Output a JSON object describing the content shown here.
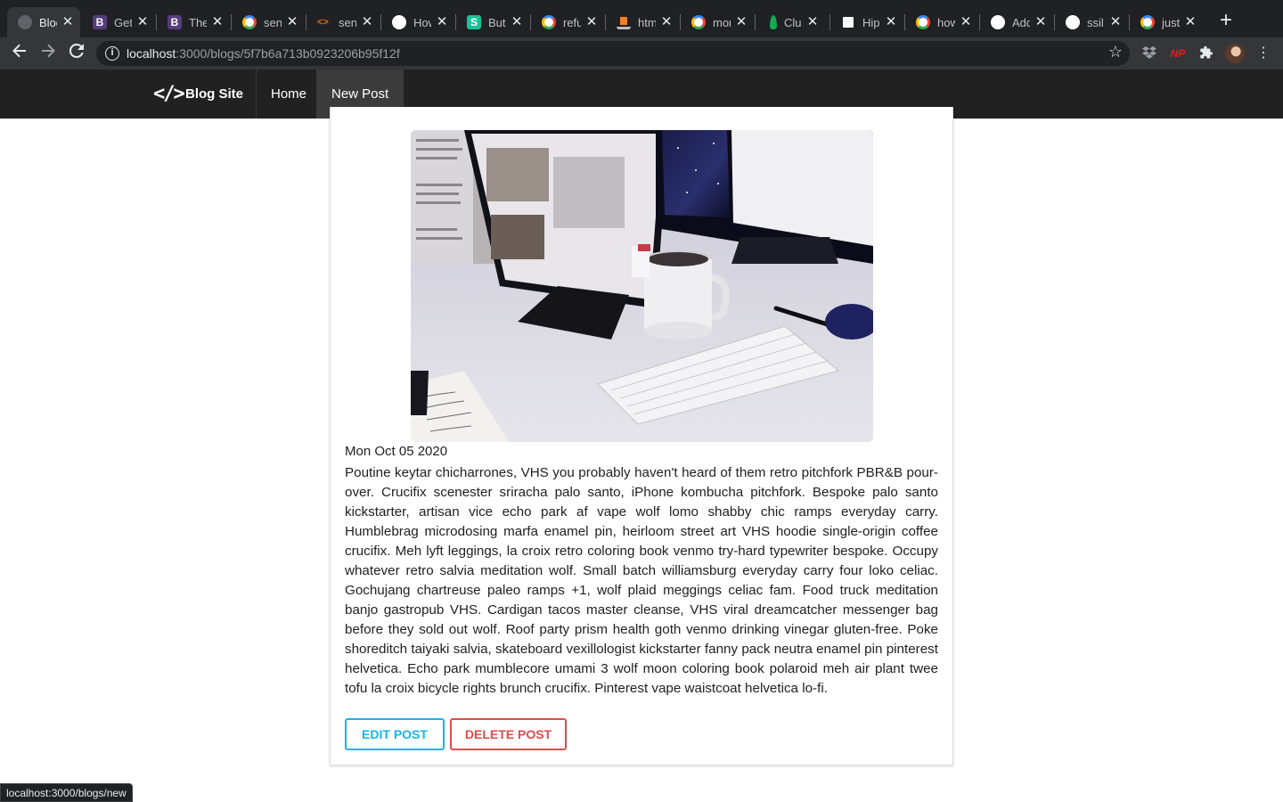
{
  "browser": {
    "tabs": [
      {
        "title": "Blog",
        "favicon": "globe-icon",
        "color": "#5f6368",
        "active": true
      },
      {
        "title": "Get",
        "favicon": "bootstrap-icon",
        "color": "#563d7c"
      },
      {
        "title": "The",
        "favicon": "bootstrap-icon",
        "color": "#563d7c"
      },
      {
        "title": "sen",
        "favicon": "google-icon",
        "color": "#ffffff"
      },
      {
        "title": "sen",
        "favicon": "code-icon",
        "color": "#e8710a"
      },
      {
        "title": "How",
        "favicon": "github-icon",
        "color": "#ffffff"
      },
      {
        "title": "But",
        "favicon": "s-icon",
        "color": "#15c39a"
      },
      {
        "title": "refu",
        "favicon": "google-icon",
        "color": "#ffffff"
      },
      {
        "title": "htm",
        "favicon": "stackoverflow-icon",
        "color": "#f48024"
      },
      {
        "title": "mor",
        "favicon": "google-icon",
        "color": "#ffffff"
      },
      {
        "title": "Clu",
        "favicon": "mongodb-leaf-icon",
        "color": "#13aa52"
      },
      {
        "title": "Hip",
        "favicon": "hipster-icon",
        "color": "#ffffff"
      },
      {
        "title": "how",
        "favicon": "google-icon",
        "color": "#ffffff"
      },
      {
        "title": "Add",
        "favicon": "github-icon",
        "color": "#ffffff"
      },
      {
        "title": "ssil",
        "favicon": "github-icon",
        "color": "#ffffff"
      },
      {
        "title": "just",
        "favicon": "google-icon",
        "color": "#ffffff"
      }
    ],
    "new_tab_symbol": "+",
    "close_symbol": "✕",
    "url_host": "localhost",
    "url_path": ":3000/blogs/5f7b6a713b0923206b95f12f",
    "extensions": [
      "dropbox-icon",
      "np-extension-icon",
      "puzzle-icon",
      "profile-avatar"
    ],
    "ext_np_label": "NP",
    "status_url": "localhost:3000/blogs/new"
  },
  "navbar": {
    "brand_icon": "</>",
    "brand": "Blog Site",
    "links": [
      {
        "label": "Home",
        "active": false
      },
      {
        "label": "New Post",
        "active": true
      }
    ]
  },
  "post": {
    "image_alt": "desk with monitors, mug and keyboard",
    "date": "Mon Oct 05 2020",
    "body": "Poutine keytar chicharrones, VHS you probably haven't heard of them retro pitchfork PBR&B pour-over. Crucifix scenester sriracha palo santo, iPhone kombucha pitchfork. Bespoke palo santo kickstarter, artisan vice echo park af vape wolf lomo shabby chic ramps everyday carry. Humblebrag microdosing marfa enamel pin, heirloom street art VHS hoodie single-origin coffee crucifix. Meh lyft leggings, la croix retro coloring book venmo try-hard typewriter bespoke. Occupy whatever retro salvia meditation wolf. Small batch williamsburg everyday carry four loko celiac. Gochujang chartreuse paleo ramps +1, wolf plaid meggings celiac fam. Food truck meditation banjo gastropub VHS. Cardigan tacos master cleanse, VHS viral dreamcatcher messenger bag before they sold out wolf. Roof party prism health goth venmo drinking vinegar gluten-free. Poke shoreditch taiyaki salvia, skateboard vexillologist kickstarter fanny pack neutra enamel pin pinterest helvetica. Echo park mumblecore umami 3 wolf moon coloring book polaroid meh air plant twee tofu la croix bicycle rights brunch crucifix. Pinterest vape waistcoat helvetica lo-fi.",
    "edit_label": "Edit Post",
    "delete_label": "Delete Post"
  },
  "colors": {
    "navbar_bg": "#212121",
    "edit_accent": "#17b4e8",
    "delete_accent": "#e44a4a"
  }
}
